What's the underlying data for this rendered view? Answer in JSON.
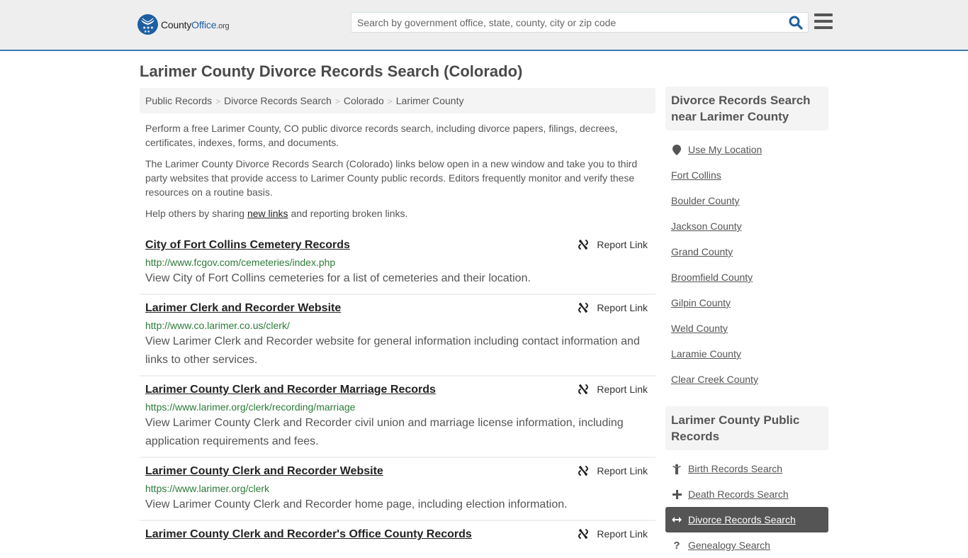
{
  "header": {
    "logo": {
      "name": "County",
      "office": "Office",
      "tld": ".org"
    },
    "search": {
      "placeholder": "Search by government office, state, county, city or zip code",
      "value": ""
    },
    "search_icon": "search-icon",
    "menu_icon": "hamburger-menu-icon"
  },
  "page": {
    "title": "Larimer County Divorce Records Search (Colorado)"
  },
  "breadcrumb": [
    {
      "label": "Public Records"
    },
    {
      "label": "Divorce Records Search"
    },
    {
      "label": "Colorado"
    },
    {
      "label": "Larimer County"
    }
  ],
  "breadcrumb_separator": ">",
  "intro": {
    "p1": "Perform a free Larimer County, CO public divorce records search, including divorce papers, filings, decrees, certificates, indexes, forms, and documents.",
    "p2": "The Larimer County Divorce Records Search (Colorado) links below open in a new window and take you to third party websites that provide access to Larimer County public records. Editors frequently monitor and verify these resources on a routine basis.",
    "p3_before": "Help others by sharing ",
    "p3_link": "new links",
    "p3_after": " and reporting broken links."
  },
  "report_label": "Report Link",
  "results": [
    {
      "title": "City of Fort Collins Cemetery Records",
      "url": "http://www.fcgov.com/cemeteries/index.php",
      "description": "View City of Fort Collins cemeteries for a list of cemeteries and their location."
    },
    {
      "title": "Larimer Clerk and Recorder Website",
      "url": "http://www.co.larimer.co.us/clerk/",
      "description": "View Larimer Clerk and Recorder website for general information including contact information and links to other services."
    },
    {
      "title": "Larimer County Clerk and Recorder Marriage Records",
      "url": "https://www.larimer.org/clerk/recording/marriage",
      "description": "View Larimer County Clerk and Recorder civil union and marriage license information, including application requirements and fees."
    },
    {
      "title": "Larimer County Clerk and Recorder Website",
      "url": "https://www.larimer.org/clerk",
      "description": "View Larimer County Clerk and Recorder home page, including election information."
    },
    {
      "title": "Larimer County Clerk and Recorder's Office County Records",
      "url": "",
      "description": ""
    }
  ],
  "sidebar": {
    "nearby": {
      "heading": "Divorce Records Search near Larimer County",
      "use_location": "Use My Location",
      "items": [
        "Fort Collins",
        "Boulder County",
        "Jackson County",
        "Grand County",
        "Broomfield County",
        "Gilpin County",
        "Weld County",
        "Laramie County",
        "Clear Creek County"
      ]
    },
    "public_records": {
      "heading": "Larimer County Public Records",
      "items": [
        {
          "label": "Birth Records Search",
          "icon": "child-icon",
          "active": false
        },
        {
          "label": "Death Records Search",
          "icon": "cross-icon",
          "active": false
        },
        {
          "label": "Divorce Records Search",
          "icon": "arrows-horizontal-icon",
          "active": true
        },
        {
          "label": "Genealogy Search",
          "icon": "question-icon",
          "active": false
        }
      ]
    }
  },
  "colors": {
    "brand_blue": "#1d5fa1",
    "header_border": "#3a7bb0",
    "url_green": "#2d7a3a",
    "active_item_bg": "#555555"
  }
}
